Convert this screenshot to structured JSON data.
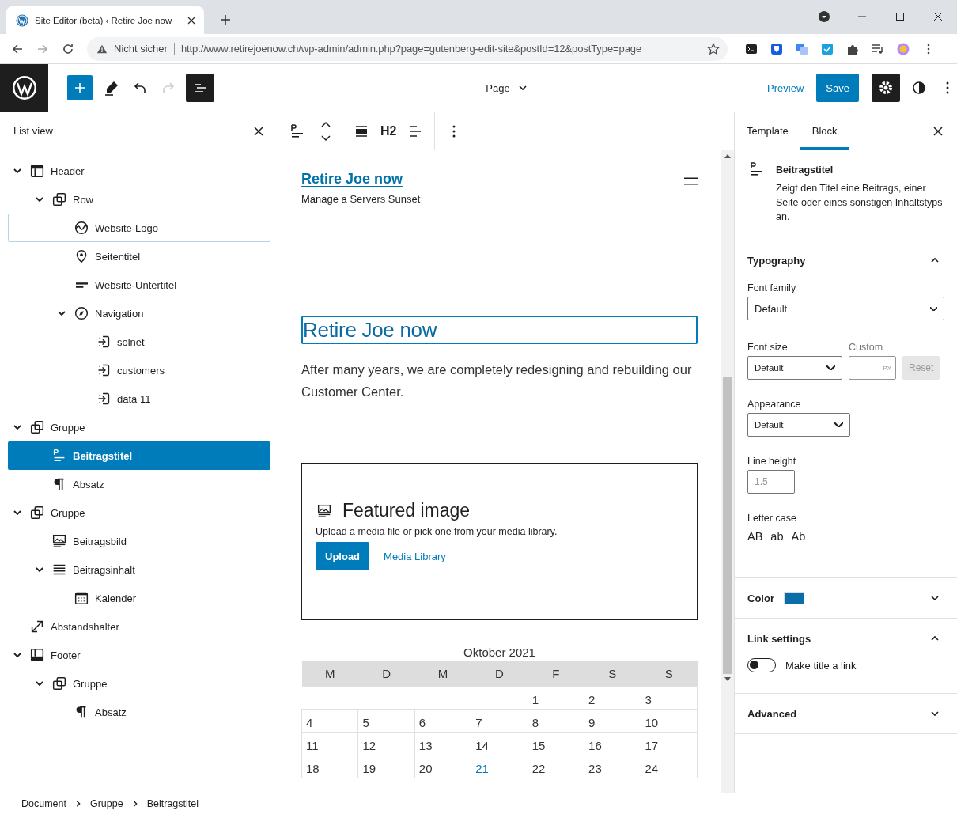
{
  "browser": {
    "tab_title": "Site Editor (beta) ‹ Retire Joe now",
    "security": "Nicht sicher",
    "url": "http://www.retirejoenow.ch/wp-admin/admin.php?page=gutenberg-edit-site&postId=12&postType=page"
  },
  "editor_bar": {
    "template_menu": "Page",
    "preview": "Preview",
    "save": "Save"
  },
  "block_toolbar": {
    "heading_level": "H2"
  },
  "list_view": {
    "title": "List view",
    "items": [
      {
        "label": "Header",
        "kind": "header",
        "selected": false,
        "hovered": false,
        "expanded": true,
        "children": [
          {
            "label": "Row",
            "kind": "group",
            "selected": false,
            "hovered": false,
            "expanded": true,
            "children": [
              {
                "label": "Website-Logo",
                "kind": "logo",
                "selected": false,
                "hovered": true
              },
              {
                "label": "Seitentitel",
                "kind": "pin",
                "selected": false,
                "hovered": false
              },
              {
                "label": "Website-Untertitel",
                "kind": "subtitle",
                "selected": false,
                "hovered": false
              },
              {
                "label": "Navigation",
                "kind": "compass",
                "selected": false,
                "hovered": false,
                "expanded": true,
                "children": [
                  {
                    "label": "solnet",
                    "kind": "link",
                    "selected": false,
                    "hovered": false
                  },
                  {
                    "label": "customers",
                    "kind": "link",
                    "selected": false,
                    "hovered": false
                  },
                  {
                    "label": "data 11",
                    "kind": "link",
                    "selected": false,
                    "hovered": false
                  }
                ]
              }
            ]
          }
        ]
      },
      {
        "label": "Gruppe",
        "kind": "group",
        "selected": false,
        "hovered": false,
        "expanded": true,
        "children": [
          {
            "label": "Beitragstitel",
            "kind": "title",
            "selected": true,
            "hovered": false
          },
          {
            "label": "Absatz",
            "kind": "paragraph",
            "selected": false,
            "hovered": false
          }
        ]
      },
      {
        "label": "Gruppe",
        "kind": "group",
        "selected": false,
        "hovered": false,
        "expanded": true,
        "children": [
          {
            "label": "Beitragsbild",
            "kind": "image",
            "selected": false,
            "hovered": false
          },
          {
            "label": "Beitragsinhalt",
            "kind": "lines",
            "selected": false,
            "hovered": false,
            "expanded": true,
            "children": [
              {
                "label": "Kalender",
                "kind": "calendar",
                "selected": false,
                "hovered": false
              }
            ]
          }
        ]
      },
      {
        "label": "Abstandshalter",
        "kind": "resize",
        "selected": false,
        "hovered": false
      },
      {
        "label": "Footer",
        "kind": "footer",
        "selected": false,
        "hovered": false,
        "expanded": true,
        "children": [
          {
            "label": "Gruppe",
            "kind": "group",
            "selected": false,
            "hovered": false,
            "expanded": true,
            "children": [
              {
                "label": "Absatz",
                "kind": "paragraph",
                "selected": false,
                "hovered": false
              }
            ]
          }
        ]
      }
    ]
  },
  "canvas": {
    "site_title": "Retire Joe now",
    "tagline": "Manage a Servers Sunset",
    "post_title": "Retire Joe now",
    "paragraph": "After many years, we are completely redesigning and rebuilding our Customer Center.",
    "featured_image": {
      "title": "Featured image",
      "hint": "Upload a media file or pick one from your media library.",
      "upload": "Upload",
      "media_library": "Media Library"
    },
    "calendar": {
      "caption": "Oktober 2021",
      "weekdays": [
        "M",
        "D",
        "M",
        "D",
        "F",
        "S",
        "S"
      ],
      "weeks": [
        {
          "pad": true,
          "days": [
            {
              "label": "1",
              "linked": false
            },
            {
              "label": "2",
              "linked": false
            },
            {
              "label": "3",
              "linked": false
            }
          ]
        },
        {
          "pad": false,
          "days": [
            {
              "label": "4",
              "linked": false
            },
            {
              "label": "5",
              "linked": false
            },
            {
              "label": "6",
              "linked": false
            },
            {
              "label": "7",
              "linked": false
            },
            {
              "label": "8",
              "linked": false
            },
            {
              "label": "9",
              "linked": false
            },
            {
              "label": "10",
              "linked": false
            }
          ]
        },
        {
          "pad": false,
          "days": [
            {
              "label": "11",
              "linked": false
            },
            {
              "label": "12",
              "linked": false
            },
            {
              "label": "13",
              "linked": false
            },
            {
              "label": "14",
              "linked": false
            },
            {
              "label": "15",
              "linked": false
            },
            {
              "label": "16",
              "linked": false
            },
            {
              "label": "17",
              "linked": false
            }
          ]
        },
        {
          "pad": false,
          "days": [
            {
              "label": "18",
              "linked": false
            },
            {
              "label": "19",
              "linked": false
            },
            {
              "label": "20",
              "linked": false
            },
            {
              "label": "21",
              "linked": true
            },
            {
              "label": "22",
              "linked": false
            },
            {
              "label": "23",
              "linked": false
            },
            {
              "label": "24",
              "linked": false
            }
          ]
        }
      ]
    }
  },
  "inspector": {
    "tabs": [
      {
        "label": "Template",
        "selected": false
      },
      {
        "label": "Block",
        "selected": true
      }
    ],
    "block": {
      "title": "Beitragstitel",
      "description": "Zeigt den Titel eine Beitrags, einer Seite oder eines sonstigen Inhaltstyps an."
    },
    "typography": {
      "title": "Typography",
      "expanded": true,
      "font_family": {
        "label": "Font family",
        "value": "Default"
      },
      "font_size": {
        "label": "Font size",
        "value": "Default"
      },
      "custom": {
        "label": "Custom",
        "unit": "PX"
      },
      "reset": "Reset",
      "appearance": {
        "label": "Appearance",
        "value": "Default"
      },
      "line_height": {
        "label": "Line height",
        "placeholder": "1.5"
      },
      "letter_case": {
        "label": "Letter case",
        "options": [
          "AB",
          "ab",
          "Ab"
        ]
      }
    },
    "color": {
      "title": "Color",
      "expanded": false,
      "color": "#0b6ea8"
    },
    "link_settings": {
      "title": "Link settings",
      "expanded": true,
      "toggle": {
        "label": "Make title a link",
        "on": false
      }
    },
    "advanced": {
      "title": "Advanced",
      "expanded": false
    }
  },
  "breadcrumbs": [
    "Document",
    "Gruppe",
    "Beitragstitel"
  ]
}
